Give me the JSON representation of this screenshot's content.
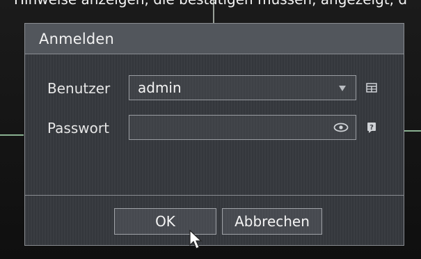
{
  "top_caption": "Hinweise anzeigen, die bestätigen müssen, angezeigt, d",
  "dialog": {
    "title": "Anmelden",
    "user": {
      "label": "Benutzer",
      "value": "admin",
      "dropdown_icon": "chevron-down-icon",
      "side_icon": "user-list-icon"
    },
    "password": {
      "label": "Passwort",
      "value": "",
      "toggle_icon": "eye-icon",
      "side_icon": "question-icon"
    },
    "buttons": {
      "ok_label": "OK",
      "cancel_label": "Abbrechen"
    }
  },
  "colors": {
    "dialog_bg": "#3a3d42",
    "header_bg": "#52565c",
    "border": "#8a8d92",
    "text": "#f2f2f2"
  }
}
